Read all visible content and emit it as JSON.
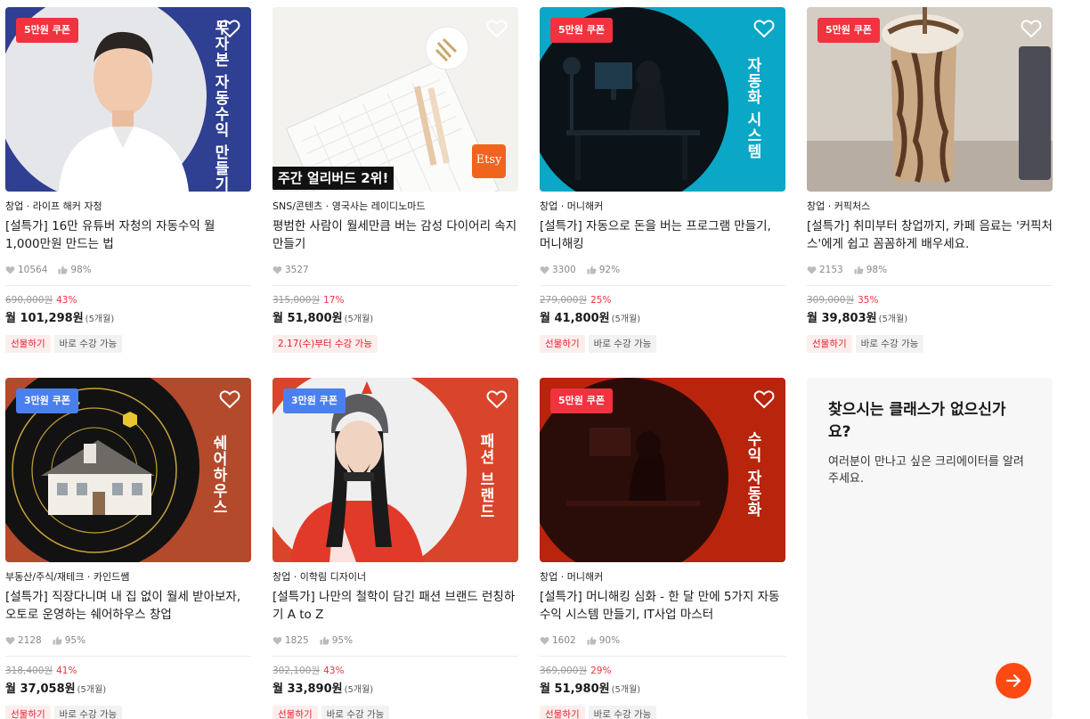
{
  "cards": [
    {
      "badge": "5만원 쿠폰",
      "overlay_text": "무자본 자동수익 만들기",
      "category": "창업 · 라이프 해커 자청",
      "title": "[설특가] 16만 유튜버 자청의 자동수익 월 1,000만원 만드는 법",
      "likes": "10564",
      "rating": "98%",
      "original_price": "690,000원",
      "discount": "43%",
      "price": "월 101,298원",
      "months": "(5개월)",
      "tag1": "선물하기",
      "tag2": "바로 수강 가능"
    },
    {
      "badge": "",
      "ribbon": "주간 얼리버드 2위!",
      "logo_text": "Etsy",
      "category": "SNS/콘텐츠 · 영국사는 레이디노마드",
      "title": "평범한 사람이 월세만큼 버는 감성 다이어리 속지 만들기",
      "likes": "3527",
      "rating": "",
      "original_price": "315,000원",
      "discount": "17%",
      "price": "월 51,800원",
      "months": "(5개월)",
      "tag1": "2.17(수)부터 수강 가능",
      "tag2": ""
    },
    {
      "badge": "5만원 쿠폰",
      "overlay_text": "자동화 시스템",
      "category": "창업 · 머니해커",
      "title": "[설특가] 자동으로 돈을 버는 프로그램 만들기, 머니해킹",
      "likes": "3300",
      "rating": "92%",
      "original_price": "279,000원",
      "discount": "25%",
      "price": "월 41,800원",
      "months": "(5개월)",
      "tag1": "선물하기",
      "tag2": "바로 수강 가능"
    },
    {
      "badge": "5만원 쿠폰",
      "category": "창업 · 커픽처스",
      "title": "[설특가] 취미부터 창업까지, 카페 음료는 '커픽처스'에게 쉽고 꼼꼼하게 배우세요.",
      "likes": "2153",
      "rating": "98%",
      "original_price": "309,000원",
      "discount": "35%",
      "price": "월 39,803원",
      "months": "(5개월)",
      "tag1": "선물하기",
      "tag2": "바로 수강 가능"
    },
    {
      "badge": "3만원 쿠폰",
      "overlay_text": "쉐어하우스",
      "category": "부동산/주식/재테크 · 카인드쌤",
      "title": "[설특가] 직장다니며 내 집 없이 월세 받아보자, 오토로 운영하는 쉐어하우스 창업",
      "likes": "2128",
      "rating": "95%",
      "original_price": "318,400원",
      "discount": "41%",
      "price": "월 37,058원",
      "months": "(5개월)",
      "tag1": "선물하기",
      "tag2": "바로 수강 가능"
    },
    {
      "badge": "3만원 쿠폰",
      "overlay_text": "패션 브랜드",
      "category": "창업 · 이학림 디자이너",
      "title": "[설특가] 나만의 철학이 담긴 패션 브랜드 런칭하기 A to Z",
      "likes": "1825",
      "rating": "95%",
      "original_price": "302,100원",
      "discount": "43%",
      "price": "월 33,890원",
      "months": "(5개월)",
      "tag1": "선물하기",
      "tag2": "바로 수강 가능"
    },
    {
      "badge": "5만원 쿠폰",
      "overlay_text": "수익 자동화",
      "category": "창업 · 머니해커",
      "title": "[설특가] 머니해킹 심화 - 한 달 만에 5가지 자동 수익 시스템 만들기, IT사업 마스터",
      "likes": "1602",
      "rating": "90%",
      "original_price": "369,000원",
      "discount": "29%",
      "price": "월 51,980원",
      "months": "(5개월)",
      "tag1": "선물하기",
      "tag2": "바로 수강 가능"
    }
  ],
  "promo": {
    "title": "찾으시는 클래스가 없으신가요?",
    "description": "여러분이 만나고 싶은 크리에이터를 알려주세요.",
    "button_icon": "arrow-right-icon"
  },
  "colors": {
    "coupon_red": "#f0333e",
    "coupon_blue": "#4a7ff0",
    "discount_red": "#f0333e",
    "promo_button": "#fd4a12"
  }
}
